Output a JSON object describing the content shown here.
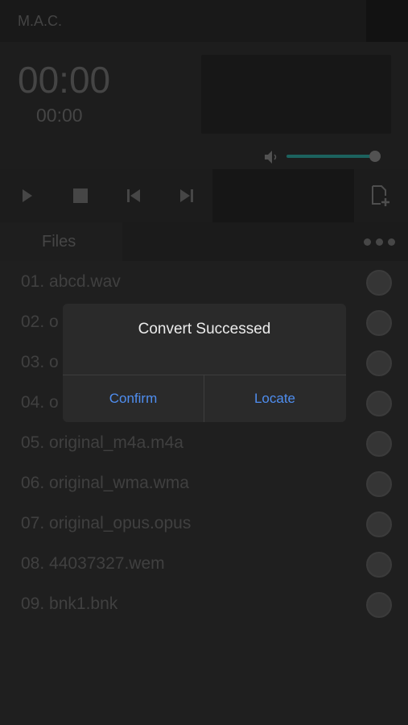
{
  "app": {
    "title": "M.A.C."
  },
  "timer": {
    "elapsed": "00:00",
    "total": "00:00"
  },
  "volume": {
    "level": 0.98,
    "accent_color": "#1f6b66"
  },
  "controls": {
    "icons": [
      "play-icon",
      "stop-icon",
      "previous-icon",
      "next-icon",
      "add-file-icon"
    ]
  },
  "files": {
    "tab_label": "Files",
    "items": [
      {
        "label": "01. abcd.wav"
      },
      {
        "label": "02. o"
      },
      {
        "label": "03. o"
      },
      {
        "label": "04. o"
      },
      {
        "label": "05. original_m4a.m4a"
      },
      {
        "label": "06. original_wma.wma"
      },
      {
        "label": "07. original_opus.opus"
      },
      {
        "label": "08. 44037327.wem"
      },
      {
        "label": "09. bnk1.bnk"
      }
    ]
  },
  "dialog": {
    "message": "Convert Successed",
    "confirm_label": "Confirm",
    "locate_label": "Locate",
    "button_color": "#4f8ef0"
  }
}
